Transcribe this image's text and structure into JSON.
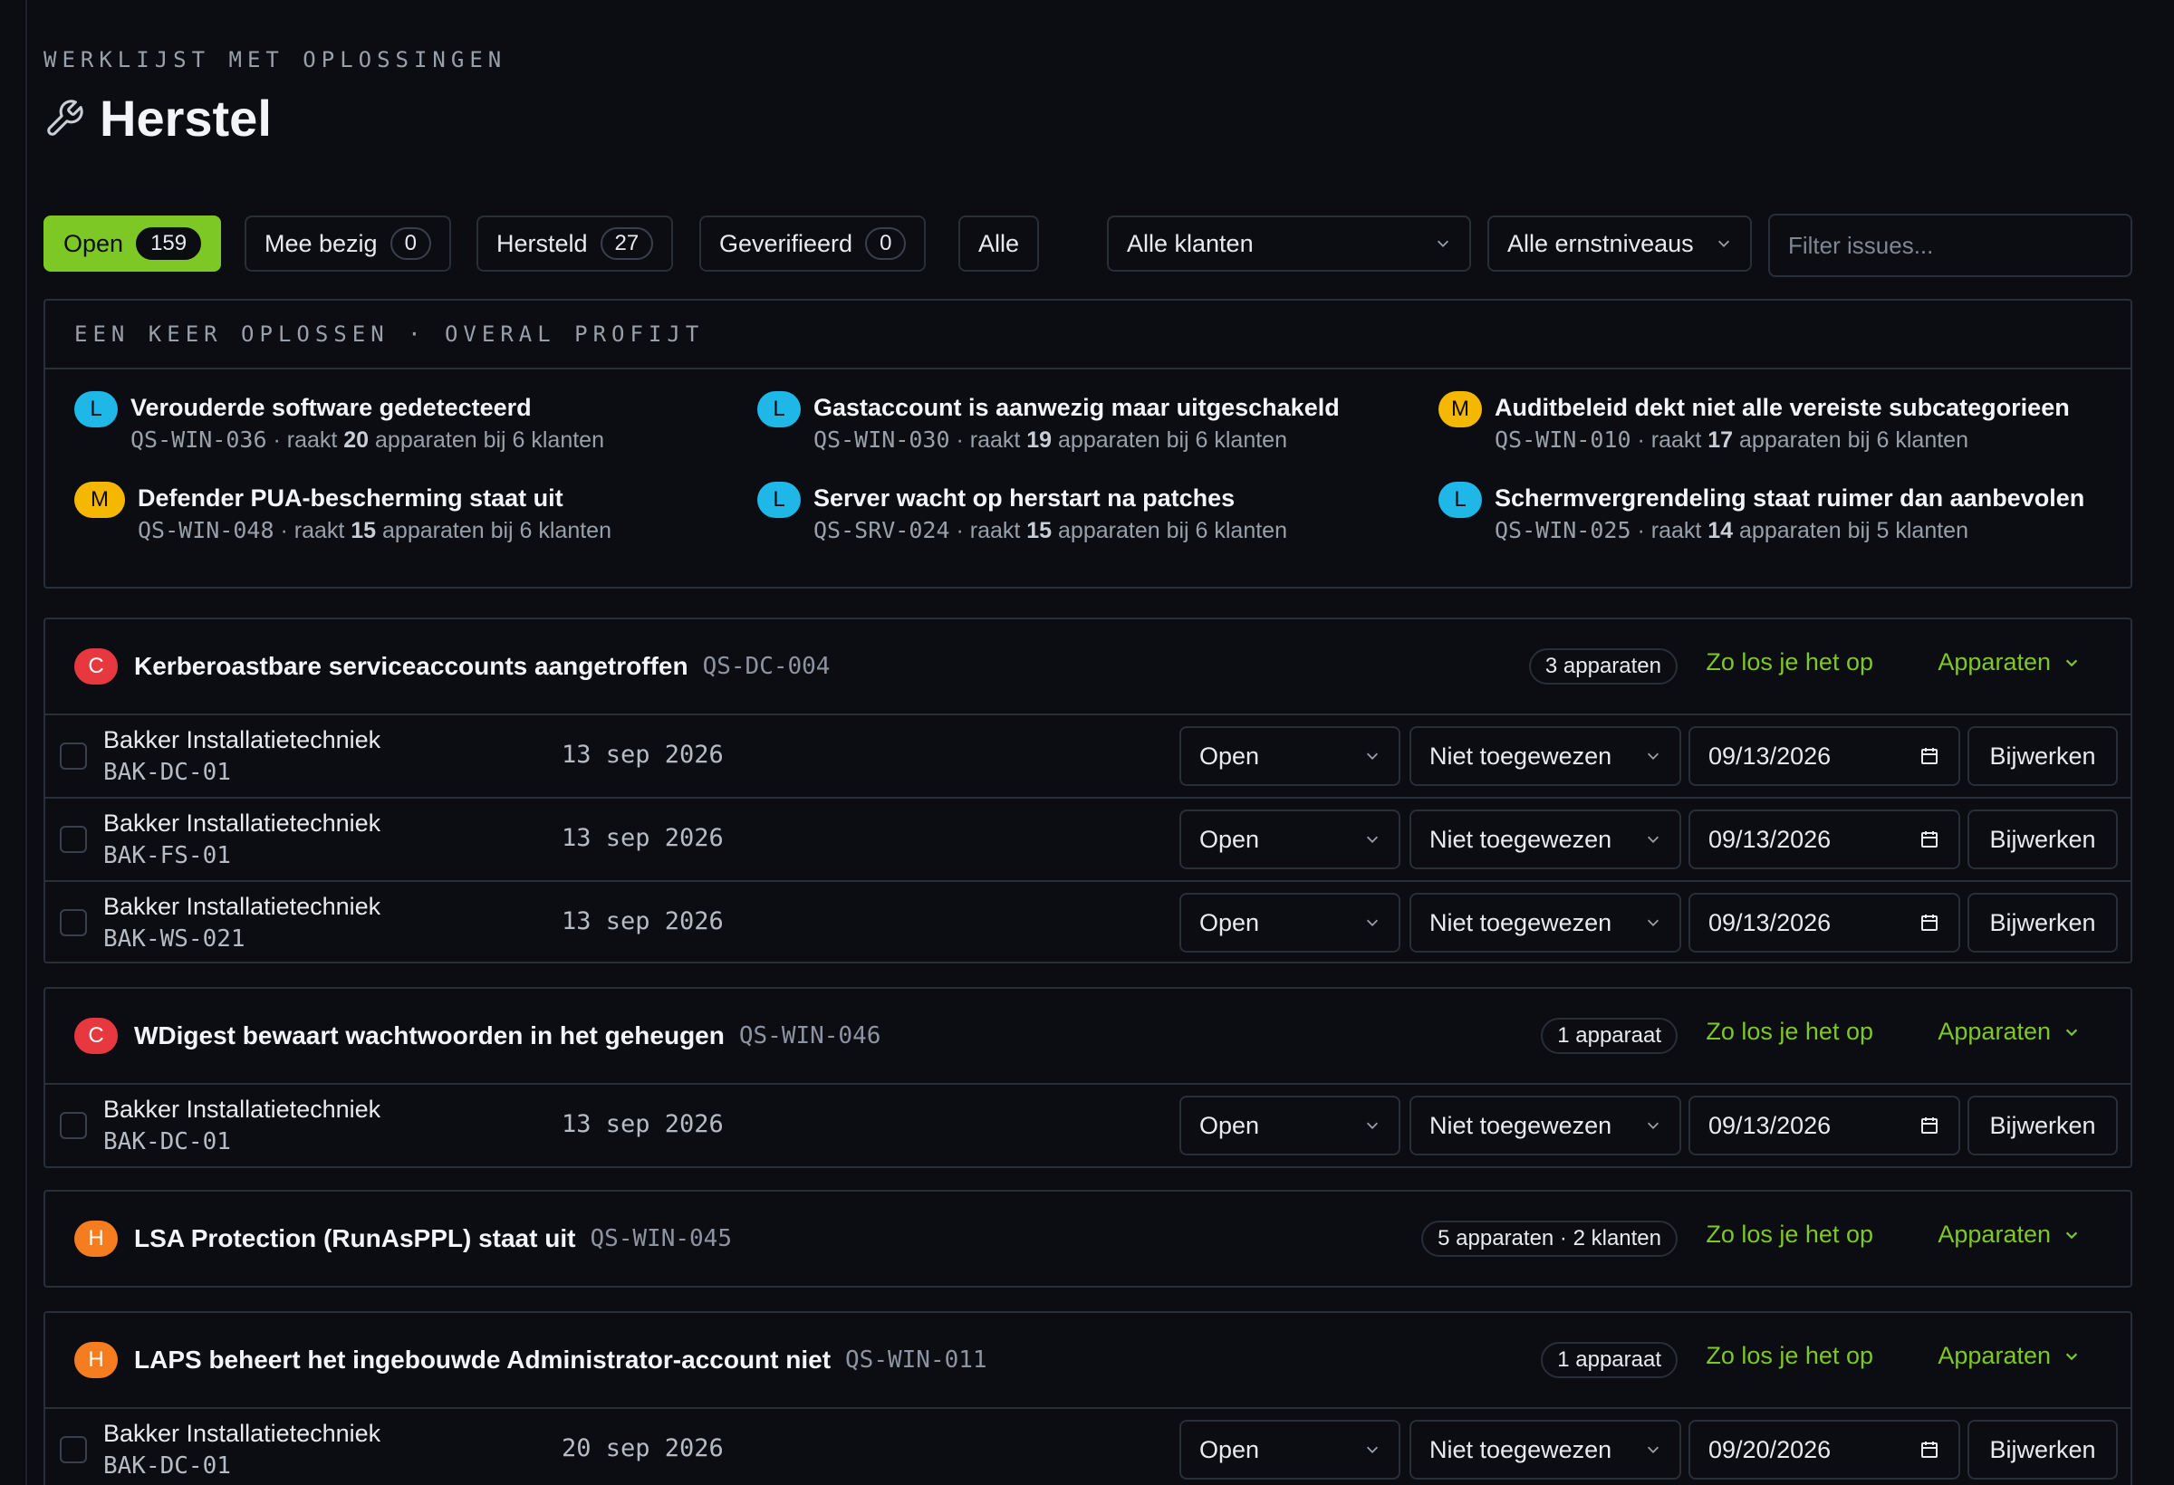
{
  "header": {
    "eyebrow": "WERKLIJST MET OPLOSSINGEN",
    "title": "Herstel",
    "icon": "wrench-icon"
  },
  "tabs": [
    {
      "label": "Open",
      "count": "159",
      "active": true
    },
    {
      "label": "Mee bezig",
      "count": "0"
    },
    {
      "label": "Hersteld",
      "count": "27"
    },
    {
      "label": "Geverifieerd",
      "count": "0"
    },
    {
      "label": "Alle"
    }
  ],
  "filters": {
    "client": "Alle klanten",
    "severity": "Alle ernstniveaus",
    "search_placeholder": "Filter issues..."
  },
  "quickfix": {
    "heading": "EEN KEER OPLOSSEN · OVERAL PROFIJT",
    "items": [
      {
        "sev": "L",
        "title": "Verouderde software gedetecteerd",
        "id": "QS-WIN-036",
        "pre": "· raakt ",
        "devices": "20",
        "post": " apparaten bij 6 klanten"
      },
      {
        "sev": "L",
        "title": "Gastaccount is aanwezig maar uitgeschakeld",
        "id": "QS-WIN-030",
        "pre": "· raakt ",
        "devices": "19",
        "post": " apparaten bij 6 klanten"
      },
      {
        "sev": "M",
        "title": "Auditbeleid dekt niet alle vereiste subcategorieen",
        "id": "QS-WIN-010",
        "pre": "· raakt ",
        "devices": "17",
        "post": " apparaten bij 6 klanten"
      },
      {
        "sev": "M",
        "title": "Defender PUA-bescherming staat uit",
        "id": "QS-WIN-048",
        "pre": "· raakt ",
        "devices": "15",
        "post": " apparaten bij 6 klanten"
      },
      {
        "sev": "L",
        "title": "Server wacht op herstart na patches",
        "id": "QS-SRV-024",
        "pre": "· raakt ",
        "devices": "15",
        "post": " apparaten bij 6 klanten"
      },
      {
        "sev": "L",
        "title": "Schermvergrendeling staat ruimer dan aanbevolen",
        "id": "QS-WIN-025",
        "pre": "· raakt ",
        "devices": "14",
        "post": " apparaten bij 5 klanten"
      }
    ]
  },
  "labels": {
    "howto": "Zo los je het op",
    "devices": "Apparaten",
    "update": "Bijwerken"
  },
  "groups": [
    {
      "sev": "C",
      "title": "Kerberoastbare serviceaccounts aangetroffen",
      "id": "QS-DC-004",
      "pill": "3 apparaten",
      "rows": [
        {
          "client": "Bakker Installatietechniek",
          "host": "BAK-DC-01",
          "date": "13 sep 2026",
          "status": "Open",
          "assignee": "Niet toegewezen",
          "due": "09/13/2026"
        },
        {
          "client": "Bakker Installatietechniek",
          "host": "BAK-FS-01",
          "date": "13 sep 2026",
          "status": "Open",
          "assignee": "Niet toegewezen",
          "due": "09/13/2026"
        },
        {
          "client": "Bakker Installatietechniek",
          "host": "BAK-WS-021",
          "date": "13 sep 2026",
          "status": "Open",
          "assignee": "Niet toegewezen",
          "due": "09/13/2026"
        }
      ]
    },
    {
      "sev": "C",
      "title": "WDigest bewaart wachtwoorden in het geheugen",
      "id": "QS-WIN-046",
      "pill": "1 apparaat",
      "rows": [
        {
          "client": "Bakker Installatietechniek",
          "host": "BAK-DC-01",
          "date": "13 sep 2026",
          "status": "Open",
          "assignee": "Niet toegewezen",
          "due": "09/13/2026"
        }
      ]
    },
    {
      "sev": "H",
      "title": "LSA Protection (RunAsPPL) staat uit",
      "id": "QS-WIN-045",
      "pill": "5 apparaten · 2 klanten",
      "rows": []
    },
    {
      "sev": "H",
      "title": "LAPS beheert het ingebouwde Administrator-account niet",
      "id": "QS-WIN-011",
      "pill": "1 apparaat",
      "rows": [
        {
          "client": "Bakker Installatietechniek",
          "host": "BAK-DC-01",
          "date": "20 sep 2026",
          "status": "Open",
          "assignee": "Niet toegewezen",
          "due": "09/20/2026"
        }
      ]
    }
  ]
}
